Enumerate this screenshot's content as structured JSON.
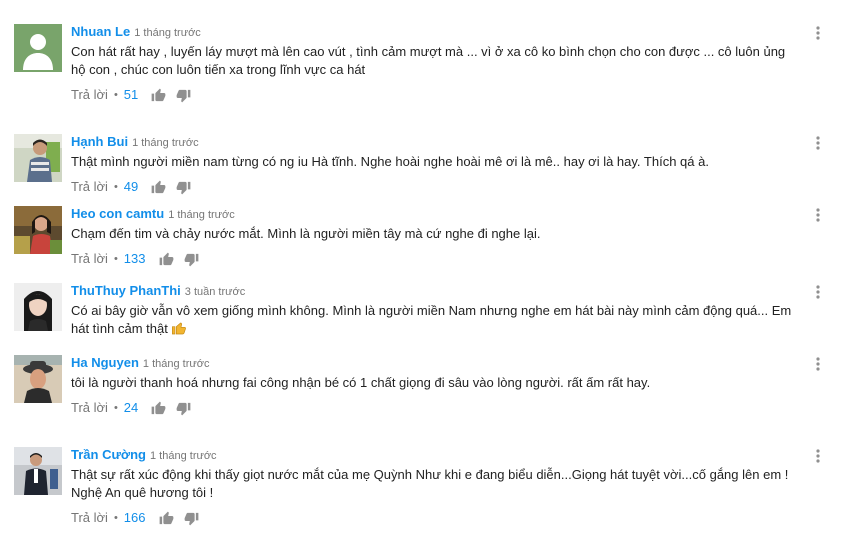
{
  "ui": {
    "reply_label": "Trả lời",
    "separator": "•",
    "colors": {
      "author": "#128ee9",
      "text": "#222222",
      "meta": "#767676",
      "icon": "#909090"
    }
  },
  "comments": [
    {
      "author": "Nhuan Le",
      "time": "1 tháng trước",
      "text": "Con hát rất hay , luyến láy mượt mà lên cao vút , tình cảm mượt mà ... vì ở xa cô ko bình chọn cho con được ... cô luôn ủng hộ con , chúc con luôn tiến xa trong lĩnh vực ca hát",
      "likes": "51",
      "avatar": "default-avatar-icon"
    },
    {
      "author": "Hạnh Bui",
      "time": "1 tháng trước",
      "text": "Thật mình người miền nam từng có ng iu Hà tĩnh. Nghe hoài nghe hoài mê ơi là mê.. hay ơi là hay. Thích qá à.",
      "likes": "49",
      "avatar": "user-photo"
    },
    {
      "author": "Heo con camtu",
      "time": "1 tháng trước",
      "text": "Chạm đến tim và chảy nước mắt. Mình là người miền tây mà cứ nghe đi nghe lại.",
      "likes": "133",
      "avatar": "user-photo"
    },
    {
      "author": "ThuThuy PhanThi",
      "time": "3 tuần trước",
      "text": "Có ai bây giờ vẫn vô xem giống mình không. Mình là người miền Nam nhưng nghe em hát bài này mình cảm động quá... Em hát tình cảm thật",
      "emoji": "👍",
      "likes": "",
      "avatar": "user-photo"
    },
    {
      "author": "Ha Nguyen",
      "time": "1 tháng trước",
      "text": "tôi là người thanh hoá nhưng fai công nhận bé có 1 chất giọng đi sâu vào lòng người.  rất ấm rất hay.",
      "likes": "24",
      "avatar": "user-photo"
    },
    {
      "author": "Trần Cường",
      "time": "1 tháng trước",
      "text": "Thật sự rất xúc động khi thấy giọt nước mắt của mẹ Quỳnh Như khi e đang biểu diễn...Giọng hát tuyệt vời...cố gắng lên em ! Nghệ An quê hương tôi !",
      "likes": "166",
      "avatar": "user-photo"
    }
  ]
}
